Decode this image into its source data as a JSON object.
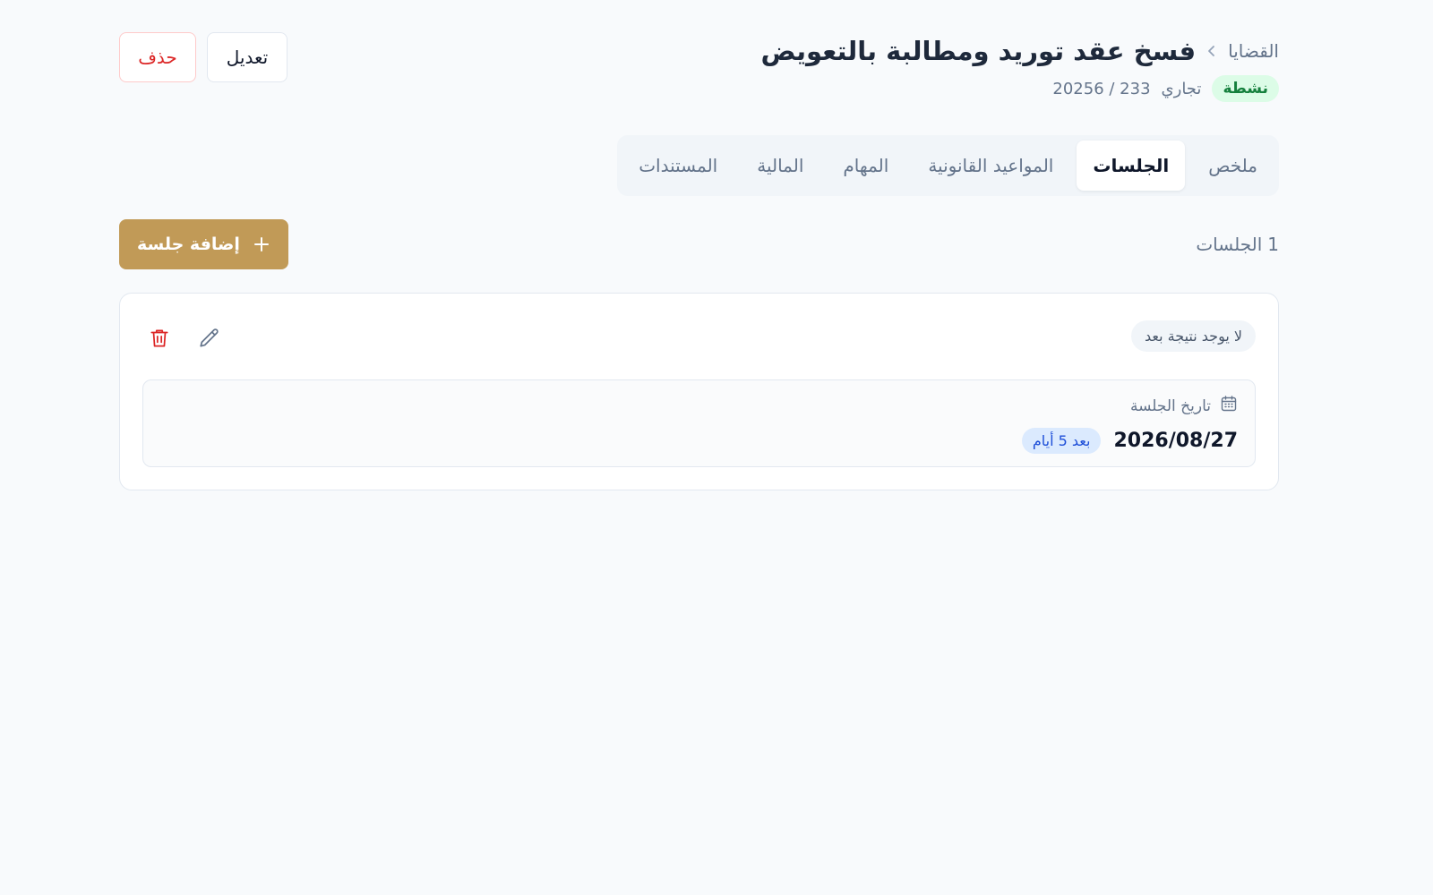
{
  "breadcrumb": {
    "parent": "القضايا",
    "separator_icon": "chevron-left-icon"
  },
  "case": {
    "title": "فسخ عقد توريد ومطالبة بالتعويض",
    "status": "نشطة",
    "type": "تجاري",
    "number": "20256 / 233"
  },
  "actions": {
    "edit_label": "تعديل",
    "delete_label": "حذف"
  },
  "tabs": [
    {
      "label": "ملخص",
      "active": false
    },
    {
      "label": "الجلسات",
      "active": true
    },
    {
      "label": "المواعيد القانونية",
      "active": false
    },
    {
      "label": "المهام",
      "active": false
    },
    {
      "label": "المالية",
      "active": false
    },
    {
      "label": "المستندات",
      "active": false
    }
  ],
  "sessions_section": {
    "count": "1",
    "count_label": "الجلسات",
    "add_button_label": "إضافة جلسة"
  },
  "sessions": [
    {
      "result_badge": "لا يوجد نتيجة بعد",
      "date_label": "تاريخ الجلسة",
      "date": "2026/08/27",
      "relative": "بعد 5 أيام"
    }
  ],
  "colors": {
    "accent": "#c19a57",
    "status_active_bg": "#dcfce7",
    "status_active_text": "#15803d",
    "danger": "#dc2626",
    "info_bg": "#dbeafe",
    "info_text": "#1d4ed8"
  }
}
